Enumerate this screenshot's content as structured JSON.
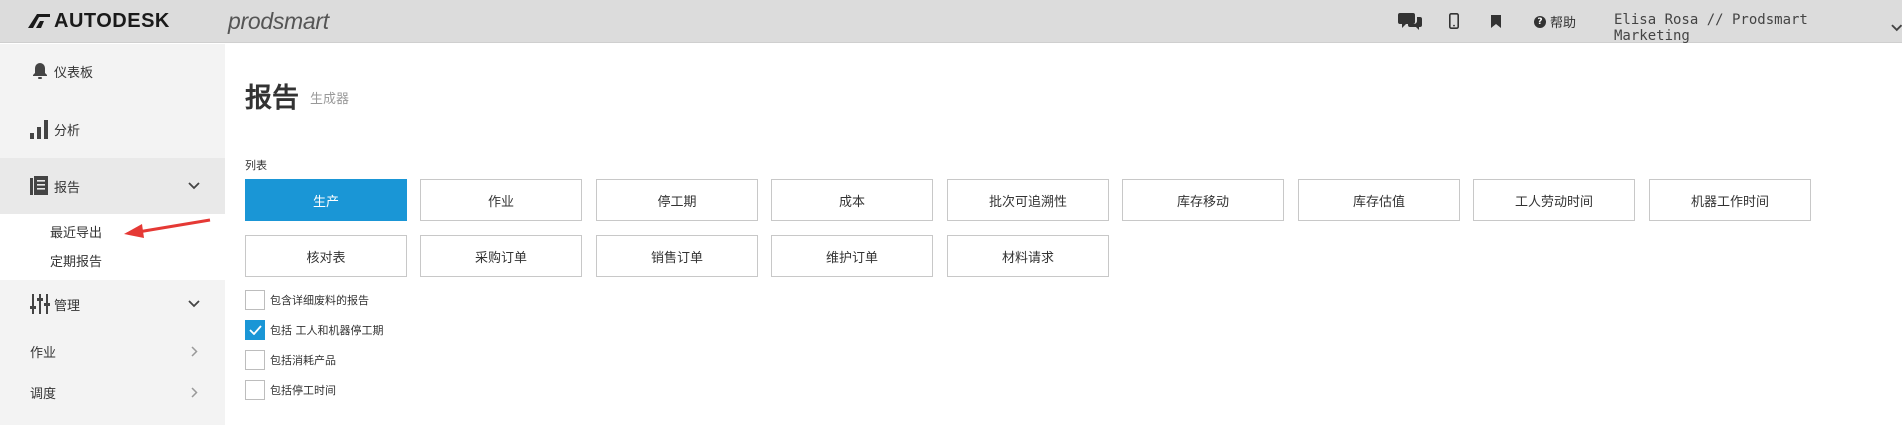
{
  "header": {
    "brand": "AUTODESK",
    "product": "prodsmart",
    "help_label": "帮助",
    "user_label": "Elisa Rosa // Prodsmart Marketing"
  },
  "sidebar": {
    "items": [
      {
        "label": "仪表板",
        "icon": "bell-icon"
      },
      {
        "label": "分析",
        "icon": "bar-chart-icon"
      },
      {
        "label": "报告",
        "icon": "report-icon"
      },
      {
        "label": "管理",
        "icon": "sliders-icon"
      },
      {
        "label": "作业"
      },
      {
        "label": "调度"
      }
    ],
    "report_sub": [
      "最近导出",
      "定期报告"
    ]
  },
  "main": {
    "title": "报告",
    "subtitle": "生成器",
    "list_label": "列表",
    "report_buttons": [
      "生产",
      "作业",
      "停工期",
      "成本",
      "批次可追溯性",
      "库存移动",
      "库存估值",
      "工人劳动时间",
      "机器工作时间",
      "核对表",
      "采购订单",
      "销售订单",
      "维护订单",
      "材料请求"
    ],
    "selected_report": "生产",
    "options": [
      {
        "label": "包含详细废料的报告",
        "checked": false
      },
      {
        "label": "包括 工人和机器停工期",
        "checked": true
      },
      {
        "label": "包括消耗产品",
        "checked": false
      },
      {
        "label": "包括停工时间",
        "checked": false
      }
    ]
  },
  "colors": {
    "accent": "#1a96d6",
    "annotation_arrow": "#e53935"
  }
}
